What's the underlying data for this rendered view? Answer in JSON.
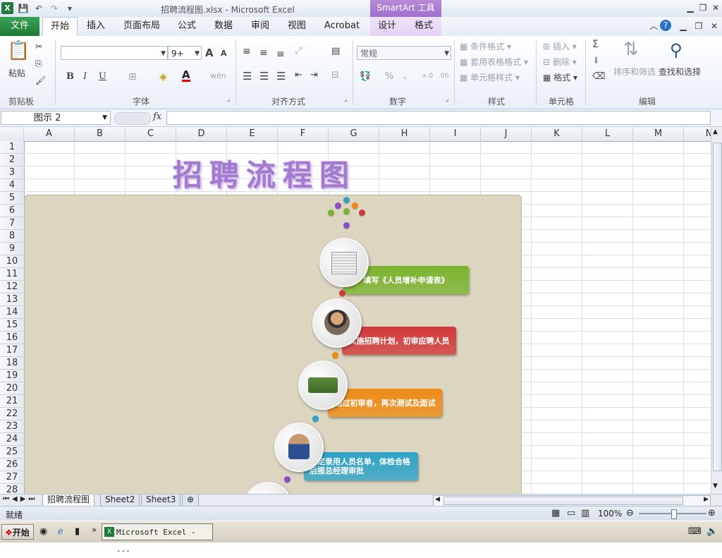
{
  "window": {
    "file_name": "招聘流程图.xlsx",
    "title_sep": " - ",
    "app_name": "Microsoft Excel",
    "context_tab_group": "SmartArt 工具"
  },
  "tabs": {
    "file": "文件",
    "items": [
      "开始",
      "插入",
      "页面布局",
      "公式",
      "数据",
      "审阅",
      "视图",
      "Acrobat",
      "设计",
      "格式"
    ]
  },
  "ribbon": {
    "clipboard": {
      "paste": "粘贴",
      "label": "剪贴板"
    },
    "font": {
      "size": "9+",
      "label": "字体",
      "bold": "B",
      "italic": "I",
      "underline": "U",
      "grow": "A",
      "shrink": "A",
      "color_a": "A",
      "wen": "wén"
    },
    "alignment": {
      "label": "对齐方式"
    },
    "number": {
      "format": "常规",
      "label": "数字",
      "percent": "%",
      "comma": ",",
      "inc": "+.0",
      "dec": ".00"
    },
    "styles": {
      "conditional": "条件格式",
      "table": "套用表格格式",
      "cell": "单元格样式",
      "label": "样式"
    },
    "cells": {
      "insert": "插入",
      "delete": "删除",
      "format": "格式",
      "label": "单元格"
    },
    "editing": {
      "sum": "Σ",
      "sort": "排序和筛选",
      "find": "查找和选择",
      "label": "编辑"
    }
  },
  "formula_bar": {
    "name_box": "图示 2",
    "fx": "fx"
  },
  "columns": [
    "A",
    "B",
    "C",
    "D",
    "E",
    "F",
    "G",
    "H",
    "I",
    "J",
    "K",
    "L",
    "M",
    "N"
  ],
  "rows": [
    "1",
    "2",
    "3",
    "4",
    "5",
    "6",
    "7",
    "8",
    "9",
    "10",
    "11",
    "12",
    "13",
    "14",
    "15",
    "16",
    "17",
    "18",
    "19",
    "20",
    "21",
    "22",
    "23",
    "24",
    "25",
    "26",
    "27",
    "28"
  ],
  "wordart": "招聘流程图",
  "smartart": {
    "steps": [
      {
        "text": "填写《人员增补申请表》",
        "color": "#7bb32e"
      },
      {
        "text": "实施招聘计划，初审应聘人员",
        "color": "#d23a3a"
      },
      {
        "text": "通过初审者，再次测试及面试",
        "color": "#ee8a16"
      },
      {
        "text": "确定录用人员名单，体检合格后报总经理审批",
        "color": "#2ea3c7"
      }
    ]
  },
  "sheets": [
    "招聘流程图",
    "Sheet2",
    "Sheet3"
  ],
  "status": {
    "ready": "就绪",
    "zoom": "100%"
  },
  "taskbar": {
    "start": "开始",
    "excel_task": "Microsoft Excel - ..."
  }
}
